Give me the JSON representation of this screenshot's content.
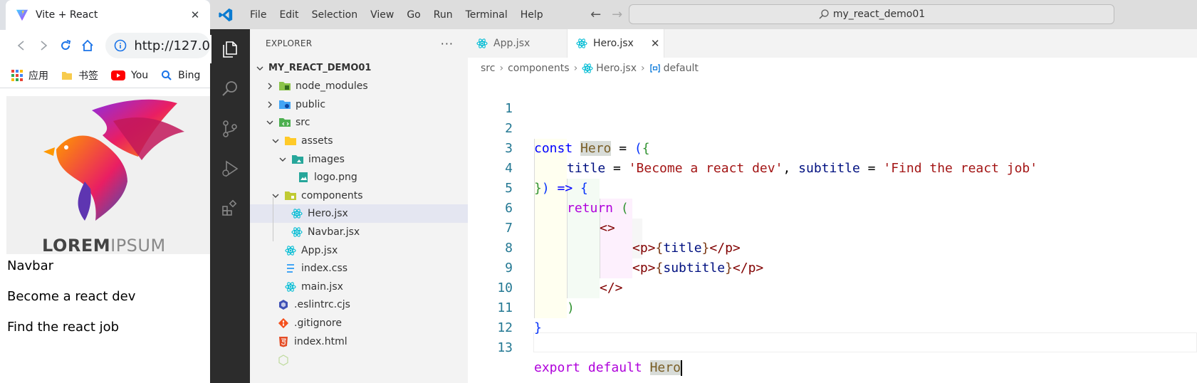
{
  "browser": {
    "tab_title": "Vite + React",
    "address": "http://127.0",
    "bookmarks": [
      {
        "label": "应用",
        "icon": "apps-grid-icon"
      },
      {
        "label": "书签",
        "icon": "bookmark-folder-icon"
      },
      {
        "label": "You",
        "icon": "youtube-icon"
      },
      {
        "label": "Bing",
        "icon": "bing-search-icon"
      }
    ],
    "page": {
      "logo_word_bold": "LOREM",
      "logo_word_light": "IPSUM",
      "navbar_text": "Navbar",
      "title_text": "Become a react dev",
      "subtitle_text": "Find the react job"
    }
  },
  "vscode": {
    "menu": [
      "File",
      "Edit",
      "Selection",
      "View",
      "Go",
      "Run",
      "Terminal",
      "Help"
    ],
    "command_center": "my_react_demo01",
    "explorer": {
      "title": "EXPLORER",
      "more": "···",
      "root": "MY_REACT_DEMO01",
      "items": [
        {
          "label": "node_modules"
        },
        {
          "label": "public"
        },
        {
          "label": "src"
        },
        {
          "label": "assets"
        },
        {
          "label": "images"
        },
        {
          "label": "logo.png"
        },
        {
          "label": "components"
        },
        {
          "label": "Hero.jsx"
        },
        {
          "label": "Navbar.jsx"
        },
        {
          "label": "App.jsx"
        },
        {
          "label": "index.css"
        },
        {
          "label": "main.jsx"
        },
        {
          "label": ".eslintrc.cjs"
        },
        {
          "label": ".gitignore"
        },
        {
          "label": "index.html"
        }
      ]
    },
    "tabs": [
      {
        "label": "App.jsx",
        "active": false
      },
      {
        "label": "Hero.jsx",
        "active": true
      }
    ],
    "breadcrumb": [
      "src",
      "components",
      "Hero.jsx",
      "default"
    ],
    "code": {
      "line_numbers": [
        "1",
        "2",
        "3",
        "4",
        "5",
        "6",
        "7",
        "8",
        "9",
        "10",
        "11",
        "12",
        "13"
      ],
      "l2": {
        "kw": "const",
        "name": "Hero",
        "eq": " = ",
        "paren": "(",
        "brace": "{"
      },
      "l3": {
        "a": "title",
        "eq1": " = ",
        "s1": "'Become a react dev'",
        "comma": ", ",
        "b": "subtitle",
        "eq2": " = ",
        "s2": "'Find the react job'"
      },
      "l4": {
        "brace": "}",
        "paren": ")",
        "arrow": " => ",
        "open": "{"
      },
      "l5": {
        "kw": "return",
        "paren": " ("
      },
      "l6": {
        "frag": "<>"
      },
      "l7": {
        "open": "<p>",
        "lb": "{",
        "v": "title",
        "rb": "}",
        "close": "</p>"
      },
      "l8": {
        "open": "<p>",
        "lb": "{",
        "v": "subtitle",
        "rb": "}",
        "close": "</p>"
      },
      "l9": {
        "frag": "</>"
      },
      "l10": {
        "paren": ")"
      },
      "l11": {
        "brace": "}"
      },
      "l13": {
        "kw1": "export",
        "kw2": " default ",
        "name": "Hero"
      }
    }
  }
}
